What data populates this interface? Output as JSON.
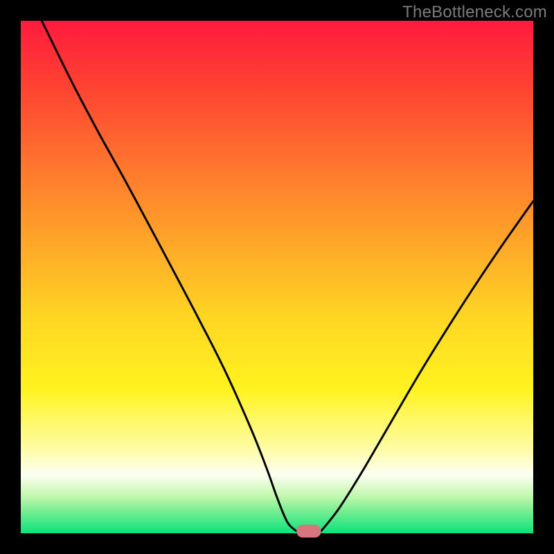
{
  "watermark": "TheBottleneck.com",
  "plot": {
    "inner_x": 30,
    "inner_y": 30,
    "inner_w": 740,
    "inner_h": 740
  },
  "gradient_stops": [
    {
      "offset": 0.0,
      "color": "#ff1a3f"
    },
    {
      "offset": 0.1,
      "color": "#ff3a33"
    },
    {
      "offset": 0.26,
      "color": "#ff6e2e"
    },
    {
      "offset": 0.42,
      "color": "#ffa229"
    },
    {
      "offset": 0.58,
      "color": "#ffd623"
    },
    {
      "offset": 0.72,
      "color": "#fff320"
    },
    {
      "offset": 0.83,
      "color": "#fffca0"
    },
    {
      "offset": 0.885,
      "color": "#fcfff1"
    },
    {
      "offset": 0.905,
      "color": "#e3fbd1"
    },
    {
      "offset": 0.93,
      "color": "#bcf7aa"
    },
    {
      "offset": 0.955,
      "color": "#7aee93"
    },
    {
      "offset": 1.0,
      "color": "#09e37d"
    }
  ],
  "chart_data": {
    "type": "line",
    "title": "",
    "xlabel": "",
    "ylabel": "",
    "xlim": [
      0,
      100
    ],
    "ylim": [
      0,
      100
    ],
    "series": [
      {
        "name": "left-limb",
        "x": [
          4.1,
          10,
          15,
          20,
          25,
          30,
          35,
          40,
          45,
          48,
          50,
          52,
          53.8
        ],
        "y": [
          100,
          88,
          78.5,
          69.5,
          60.2,
          50.8,
          41.3,
          31.4,
          20.2,
          12.6,
          7.0,
          2.2,
          0.4
        ]
      },
      {
        "name": "right-limb",
        "x": [
          58.6,
          62,
          66,
          70,
          74,
          78,
          82,
          86,
          90,
          94,
          98,
          100
        ],
        "y": [
          0.4,
          4.7,
          11.0,
          17.8,
          24.7,
          31.5,
          38.0,
          44.3,
          50.4,
          56.3,
          62.0,
          64.8
        ]
      }
    ],
    "neck_marker": {
      "x_center": 56.2,
      "width": 4.8,
      "y_center": 0.4,
      "height": 2.5,
      "color": "#d9757c"
    }
  }
}
